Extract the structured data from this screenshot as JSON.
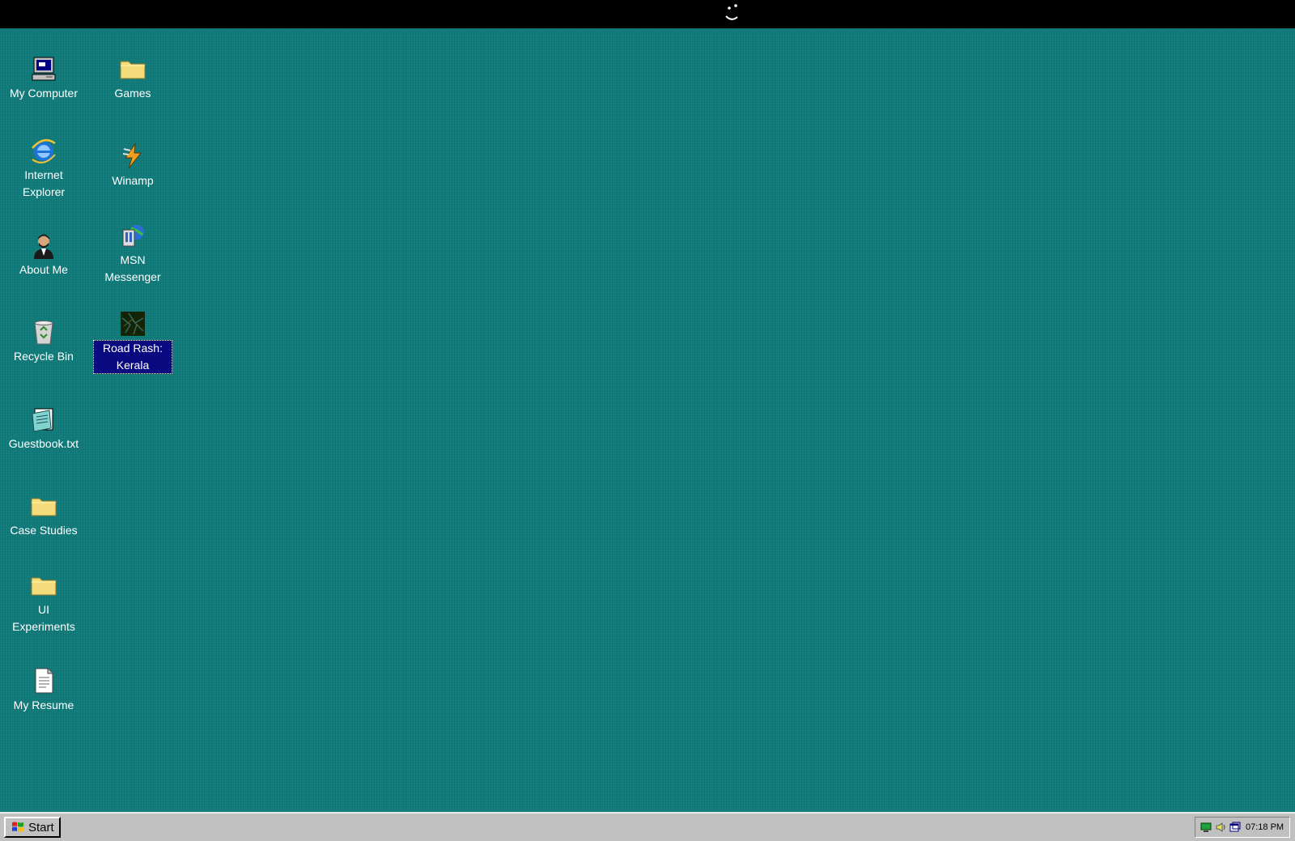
{
  "desktop": {
    "background_color": "#137f7e",
    "icons": [
      {
        "label": "My Computer",
        "icon": "computer-icon"
      },
      {
        "label": "Internet Explorer",
        "icon": "internet-explorer-icon"
      },
      {
        "label": "About Me",
        "icon": "person-icon"
      },
      {
        "label": "Recycle Bin",
        "icon": "recycle-bin-icon"
      },
      {
        "label": "Guestbook.txt",
        "icon": "notepad-icon"
      },
      {
        "label": "Case Studies",
        "icon": "folder-icon"
      },
      {
        "label": "UI Experiments",
        "icon": "folder-icon"
      },
      {
        "label": "My Resume",
        "icon": "document-icon"
      },
      {
        "label": "Games",
        "icon": "folder-icon"
      },
      {
        "label": "Winamp",
        "icon": "winamp-icon"
      },
      {
        "label": "MSN Messenger",
        "icon": "msn-messenger-icon"
      },
      {
        "label": "Road Rash: Kerala",
        "icon": "game-icon",
        "selected": true
      }
    ]
  },
  "taskbar": {
    "start_label": "Start",
    "clock": "07:18 PM",
    "tray_icons": [
      "network-icon",
      "volume-icon",
      "display-icon"
    ]
  }
}
